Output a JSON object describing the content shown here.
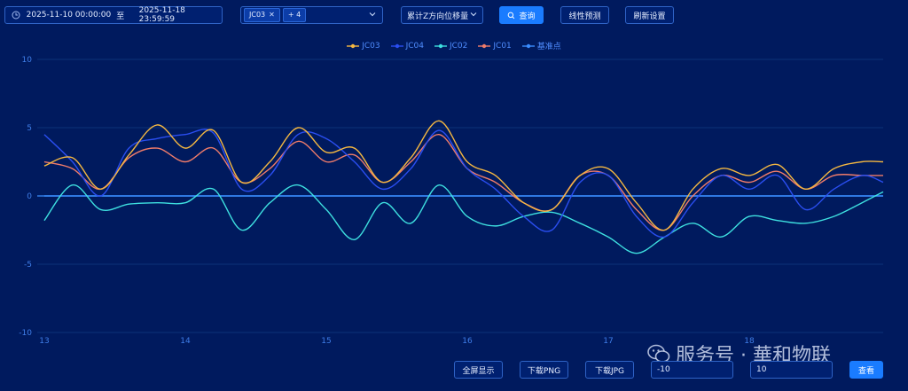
{
  "filters": {
    "date_start": "2025-11-10 00:00:00",
    "date_sep": "至",
    "date_end": "2025-11-18 23:59:59",
    "point_tag": "JC03",
    "more_tag": "+ 4",
    "metric": "累计Z方向位移量"
  },
  "buttons": {
    "query": "查询",
    "linear_forecast": "线性预测",
    "refresh_settings": "刷新设置",
    "fullscreen": "全屏显示",
    "download_png": "下载PNG",
    "download_jpg": "下载JPG",
    "view": "查看"
  },
  "range_inputs": {
    "min": "-10",
    "max": "10"
  },
  "colors": {
    "background": "#001a5e",
    "accent": "#1a7cff",
    "axis_text": "#3f7ee8",
    "grid": "#0d3278",
    "zero_line": "#3a8dff"
  },
  "watermark": "服务号 · 華和物联",
  "chart_data": {
    "type": "line",
    "ylim": [
      -10,
      10
    ],
    "y_ticks": [
      "10",
      "5",
      "0",
      "-5",
      "-10"
    ],
    "x_range": [
      12.95,
      18.95
    ],
    "x_ticks": [
      "13",
      "14",
      "15",
      "16",
      "17",
      "18"
    ],
    "legend_position": "top-center",
    "grid": true,
    "x": [
      13.0,
      13.2,
      13.4,
      13.6,
      13.8,
      14.0,
      14.2,
      14.4,
      14.6,
      14.8,
      15.0,
      15.2,
      15.4,
      15.6,
      15.8,
      16.0,
      16.2,
      16.4,
      16.6,
      16.8,
      17.0,
      17.2,
      17.4,
      17.6,
      17.8,
      18.0,
      18.2,
      18.4,
      18.6,
      18.8,
      18.95
    ],
    "series": [
      {
        "name": "JC03",
        "color": "#f5b841",
        "values": [
          2.2,
          2.8,
          0.5,
          3.0,
          5.2,
          3.5,
          4.8,
          1.0,
          2.5,
          5.0,
          3.2,
          3.5,
          1.0,
          2.8,
          5.5,
          2.5,
          1.5,
          -0.5,
          -1.0,
          1.5,
          2.0,
          -0.5,
          -2.5,
          0.5,
          2.0,
          1.5,
          2.3,
          0.5,
          2.0,
          2.5,
          2.5
        ]
      },
      {
        "name": "JC04",
        "color": "#2a4ef0",
        "values": [
          4.5,
          2.5,
          0.0,
          3.5,
          4.2,
          4.5,
          4.6,
          0.5,
          1.5,
          4.5,
          4.2,
          2.5,
          0.5,
          2.0,
          4.8,
          2.0,
          0.5,
          -1.5,
          -2.5,
          1.0,
          1.5,
          -1.5,
          -3.0,
          -0.5,
          1.5,
          0.5,
          1.5,
          -1.0,
          0.5,
          1.5,
          1.0
        ]
      },
      {
        "name": "JC02",
        "color": "#3ee0e0",
        "values": [
          -1.8,
          0.8,
          -1.0,
          -0.6,
          -0.5,
          -0.5,
          0.5,
          -2.5,
          -0.5,
          0.8,
          -1.0,
          -3.2,
          -0.5,
          -2.0,
          0.8,
          -1.5,
          -2.2,
          -1.5,
          -1.2,
          -2.0,
          -3.0,
          -4.2,
          -3.0,
          -2.0,
          -3.0,
          -1.5,
          -1.8,
          -2.0,
          -1.5,
          -0.5,
          0.3
        ]
      },
      {
        "name": "JC01",
        "color": "#f07c6a",
        "values": [
          2.5,
          2.0,
          0.5,
          2.8,
          3.5,
          2.5,
          3.5,
          1.0,
          2.0,
          4.0,
          2.5,
          3.0,
          1.0,
          2.5,
          4.5,
          2.0,
          1.0,
          -0.5,
          -1.0,
          1.5,
          1.5,
          -1.0,
          -2.5,
          0.0,
          1.5,
          1.0,
          1.8,
          0.5,
          1.5,
          1.5,
          1.5
        ]
      },
      {
        "name": "基准点",
        "color": "#3a8dff",
        "values": [
          0,
          0,
          0,
          0,
          0,
          0,
          0,
          0,
          0,
          0,
          0,
          0,
          0,
          0,
          0,
          0,
          0,
          0,
          0,
          0,
          0,
          0,
          0,
          0,
          0,
          0,
          0,
          0,
          0,
          0,
          0
        ]
      }
    ]
  }
}
